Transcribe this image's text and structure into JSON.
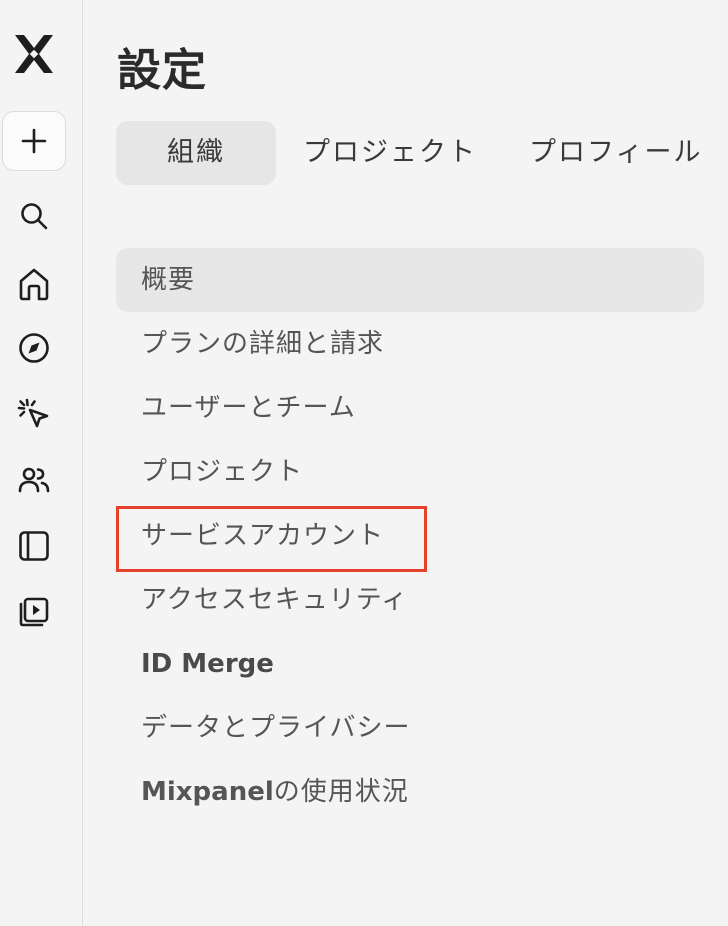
{
  "app": {
    "page_title": "設定"
  },
  "rail": {
    "icons": [
      "mixpanel-logo",
      "plus-icon",
      "search-icon",
      "home-icon",
      "compass-icon",
      "sparkle-cursor-icon",
      "users-icon",
      "sidebar-panel-icon",
      "video-library-icon"
    ]
  },
  "tabs": [
    {
      "label": "組織",
      "active": true
    },
    {
      "label": "プロジェクト",
      "active": false
    },
    {
      "label": "プロフィール",
      "active": false
    }
  ],
  "menu": [
    {
      "label": "概要",
      "active": true
    },
    {
      "label": "プランの詳細と請求"
    },
    {
      "label": "ユーザーとチーム"
    },
    {
      "label": "プロジェクト"
    },
    {
      "label": "サービスアカウント",
      "highlighted": true
    },
    {
      "label": "アクセスセキュリティ"
    },
    {
      "label": "ID Merge"
    },
    {
      "label": "データとプライバシー"
    },
    {
      "label": "Mixpanelの使用状況"
    }
  ],
  "colors": {
    "background": "#f4f4f4",
    "active_bg": "#e6e6e6",
    "highlight": "#e5412b",
    "text": "#2a2a2a"
  }
}
